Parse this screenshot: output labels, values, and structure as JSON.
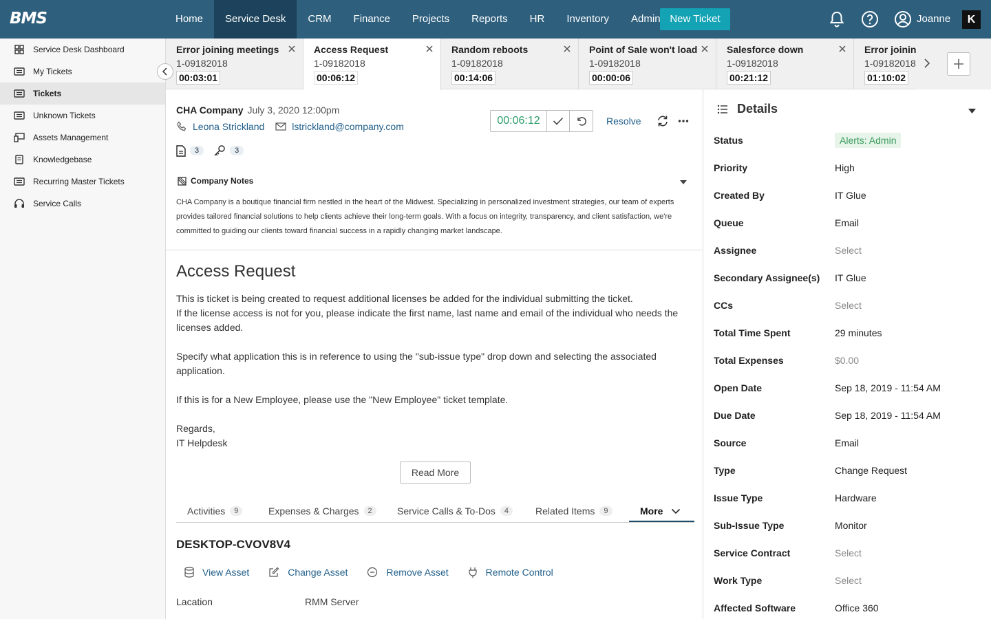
{
  "app": {
    "logo": "BMS"
  },
  "topnav": {
    "items": [
      "Home",
      "Service Desk",
      "CRM",
      "Finance",
      "Projects",
      "Reports",
      "HR",
      "Inventory",
      "Admin"
    ],
    "active": "Service Desk",
    "new_ticket_label": "New Ticket",
    "user_name": "Joanne",
    "brand_badge": "K"
  },
  "sidebar": {
    "items": [
      {
        "label": "Service Desk Dashboard",
        "icon": "dashboard-icon"
      },
      {
        "label": "My Tickets",
        "icon": "ticket-icon"
      },
      {
        "label": "Tickets",
        "icon": "ticket-icon",
        "active": true
      },
      {
        "label": "Unknown Tickets",
        "icon": "ticket-icon"
      },
      {
        "label": "Assets Management",
        "icon": "devices-icon"
      },
      {
        "label": "Knowledgebase",
        "icon": "book-icon"
      },
      {
        "label": "Recurring Master Tickets",
        "icon": "ticket-icon"
      },
      {
        "label": "Service Calls",
        "icon": "headset-icon"
      }
    ]
  },
  "ticket_tabs": [
    {
      "title": "Error joining meetings",
      "number": "1-09182018",
      "time": "00:03:01"
    },
    {
      "title": "Access Request",
      "number": "1-09182018",
      "time": "00:06:12",
      "active": true
    },
    {
      "title": "Random reboots",
      "number": "1-09182018",
      "time": "00:14:06"
    },
    {
      "title": "Point of Sale won't load",
      "number": "1-09182018",
      "time": "00:00:06"
    },
    {
      "title": "Salesforce down",
      "number": "1-09182018",
      "time": "00:21:12"
    },
    {
      "title": "Error joining",
      "number": "1-09182018",
      "time": "01:10:02"
    }
  ],
  "ticket": {
    "company": "CHA Company",
    "date": "July 3, 2020 12:00pm",
    "contact_name": "Leona Strickland",
    "contact_email": "lstrickland@company.com",
    "attachments_count": "3",
    "keys_count": "3",
    "timer": "00:06:12",
    "resolve_label": "Resolve",
    "company_notes_label": "Company Notes",
    "company_notes": "CHA Company is a boutique financial firm nestled in the heart of the Midwest. Specializing in personalized investment strategies, our team of experts provides tailored financial solutions to help clients achieve their long-term goals. With a focus on integrity, transparency, and client satisfaction, we're committed to guiding our clients toward financial success in a rapidly changing market landscape.",
    "title": "Access Request",
    "body_p1_l1": "This is ticket is being created to request additional licenses be added for the individual submitting the ticket.",
    "body_p1_l2": "If the license access is not for you, please indicate the first name, last name and email of the individual who needs the licenses added.",
    "body_p2": "Specify what application this is in reference to using the \"sub-issue type\" drop down and selecting the associated application.",
    "body_p3": "If this is for a New Employee, please use the \"New Employee\" ticket template.",
    "body_sign1": "Regards,",
    "body_sign2": "IT Helpdesk",
    "read_more_label": "Read More"
  },
  "subtabs": [
    {
      "label": "Activities",
      "count": "9"
    },
    {
      "label": "Expenses & Charges",
      "count": "2"
    },
    {
      "label": "Service Calls & To-Dos",
      "count": "4"
    },
    {
      "label": "Related Items",
      "count": "9"
    }
  ],
  "more_label": "More",
  "asset": {
    "name": "DESKTOP-CVOV8V4",
    "actions": [
      "View Asset",
      "Change Asset",
      "Remove Asset",
      "Remote Control"
    ],
    "location_label": "Lacation",
    "location_value": "RMM Server"
  },
  "details": {
    "title": "Details",
    "rows": [
      {
        "label": "Status",
        "value": "Alerts: Admin"
      },
      {
        "label": "Priority",
        "value": "High"
      },
      {
        "label": "Created By",
        "value": "IT Glue"
      },
      {
        "label": "Queue",
        "value": "Email"
      },
      {
        "label": "Assignee",
        "value": "Select"
      },
      {
        "label": "Secondary Assignee(s)",
        "value": "IT Glue"
      },
      {
        "label": "CCs",
        "value": "Select"
      },
      {
        "label": "Total Time Spent",
        "value": "29 minutes"
      },
      {
        "label": "Total Expenses",
        "value": "$0.00"
      },
      {
        "label": "Open Date",
        "value": "Sep 18, 2019 - 11:54 AM"
      },
      {
        "label": "Due Date",
        "value": "Sep 18, 2019 - 11:54 AM"
      },
      {
        "label": "Source",
        "value": "Email"
      },
      {
        "label": "Type",
        "value": "Change Request"
      },
      {
        "label": "Issue Type",
        "value": "Hardware"
      },
      {
        "label": "Sub-Issue Type",
        "value": "Monitor"
      },
      {
        "label": "Service Contract",
        "value": "Select"
      },
      {
        "label": "Work Type",
        "value": "Select"
      },
      {
        "label": "Affected Software",
        "value": "Office 360"
      }
    ]
  },
  "colors": {
    "nav_bg": "#2e5f7d",
    "nav_active": "#1c435b",
    "accent": "#13a3b5",
    "link": "#1f5e8a",
    "timer": "#2c9d6b"
  }
}
